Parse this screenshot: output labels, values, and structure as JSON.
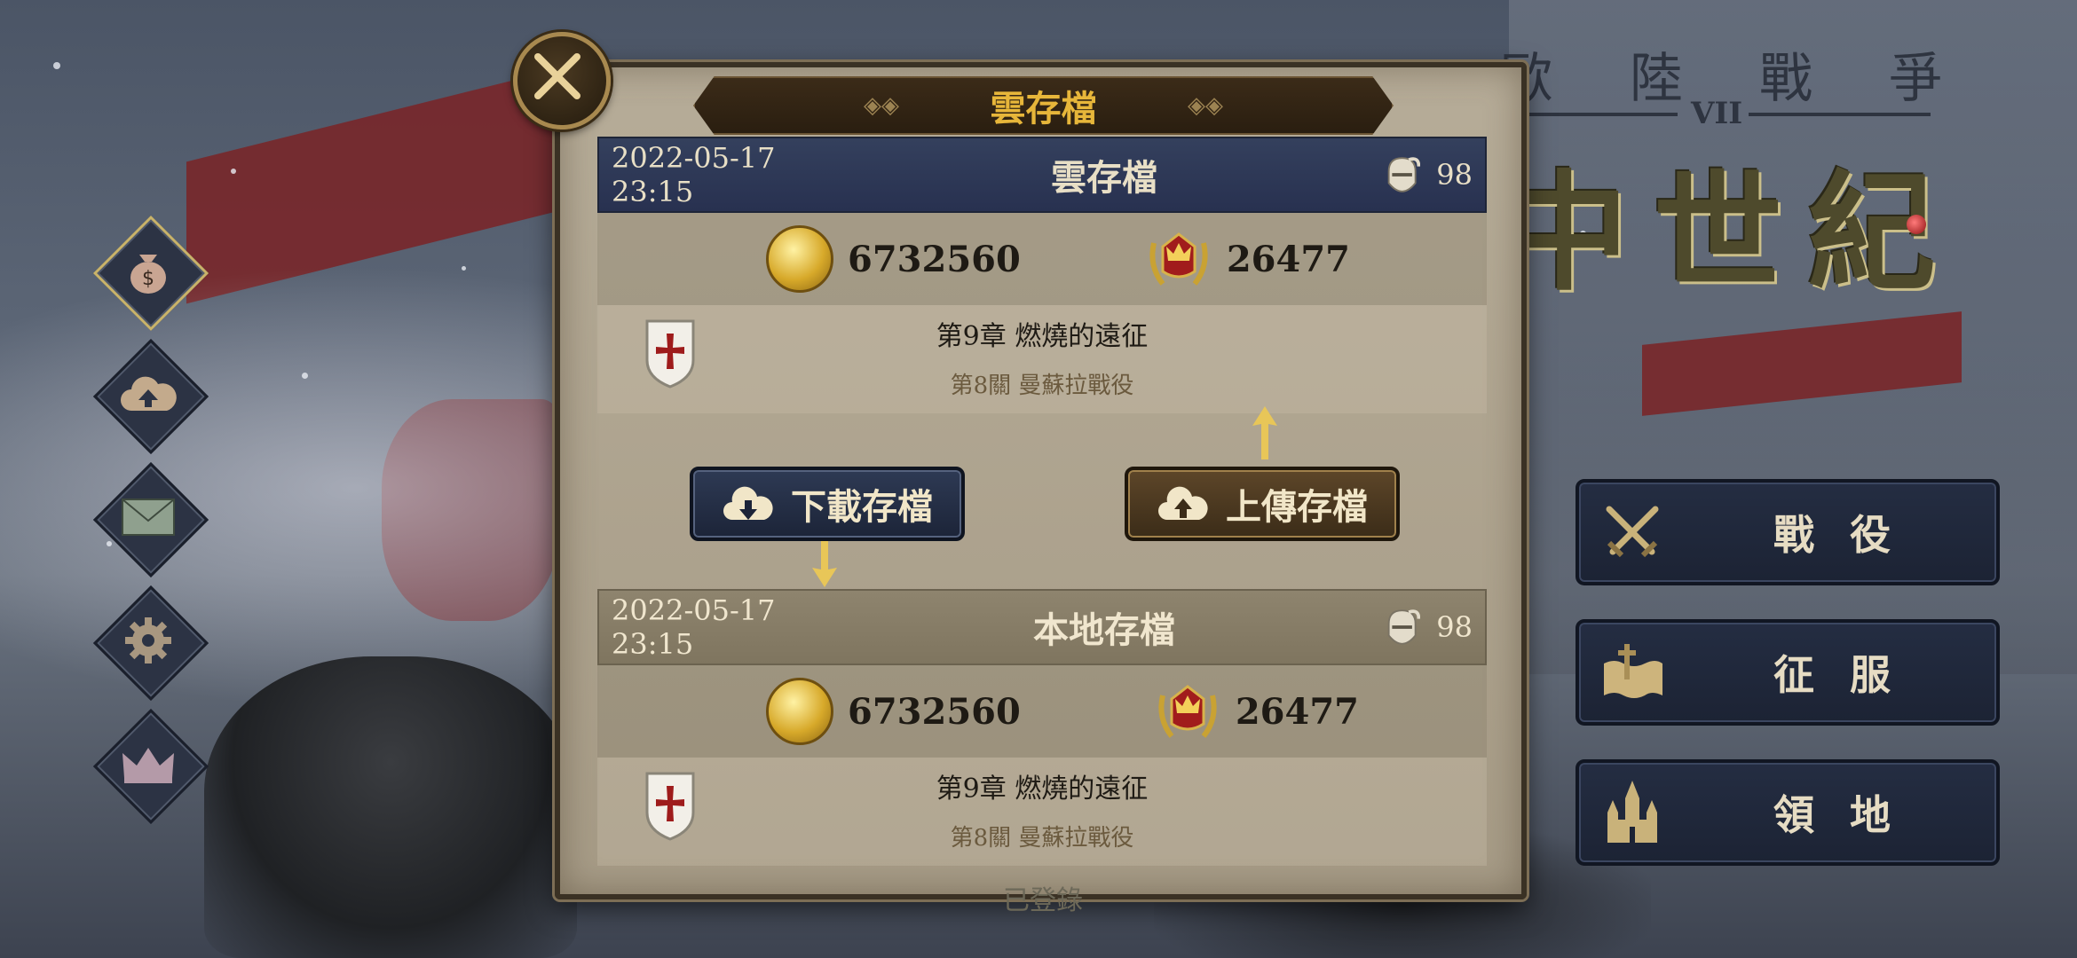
{
  "logo": {
    "subtitle_chars": [
      "歐",
      "陸",
      "戰",
      "爭"
    ],
    "numeral": "VII",
    "title_chars": [
      "中",
      "世",
      "紀"
    ]
  },
  "side_menu": [
    {
      "name": "shop-money-bag",
      "icon": "money-bag-icon",
      "active": true
    },
    {
      "name": "cloud-save",
      "icon": "cloud-upload-icon",
      "active": false
    },
    {
      "name": "mail",
      "icon": "envelope-icon",
      "active": false
    },
    {
      "name": "settings",
      "icon": "gear-icon",
      "active": false
    },
    {
      "name": "achievements",
      "icon": "crown-icon",
      "active": false
    }
  ],
  "right_menu": [
    {
      "label": "戰役",
      "icon": "crossed-swords-icon"
    },
    {
      "label": "征服",
      "icon": "map-scroll-sword-icon"
    },
    {
      "label": "領地",
      "icon": "cathedral-icon"
    }
  ],
  "dialog": {
    "title": "雲存檔",
    "cloud_save": {
      "date": "2022-05-17 23:15",
      "name": "雲存檔",
      "level": "98",
      "gold": "6732560",
      "medals": "26477",
      "chapter": "第9章 燃燒的遠征",
      "stage": "第8關 曼蘇拉戰役"
    },
    "download_button": "下載存檔",
    "upload_button": "上傳存檔",
    "local_save": {
      "date": "2022-05-17 23:15",
      "name": "本地存檔",
      "level": "98",
      "gold": "6732560",
      "medals": "26477",
      "chapter": "第9章 燃燒的遠征",
      "stage": "第8關 曼蘇拉戰役"
    }
  },
  "footer": {
    "login_status": "已登錄"
  },
  "colors": {
    "title_gold": "#e7b63a",
    "cloud_header": "#283150",
    "local_header": "#7f755f",
    "panel": "#a69b86"
  }
}
